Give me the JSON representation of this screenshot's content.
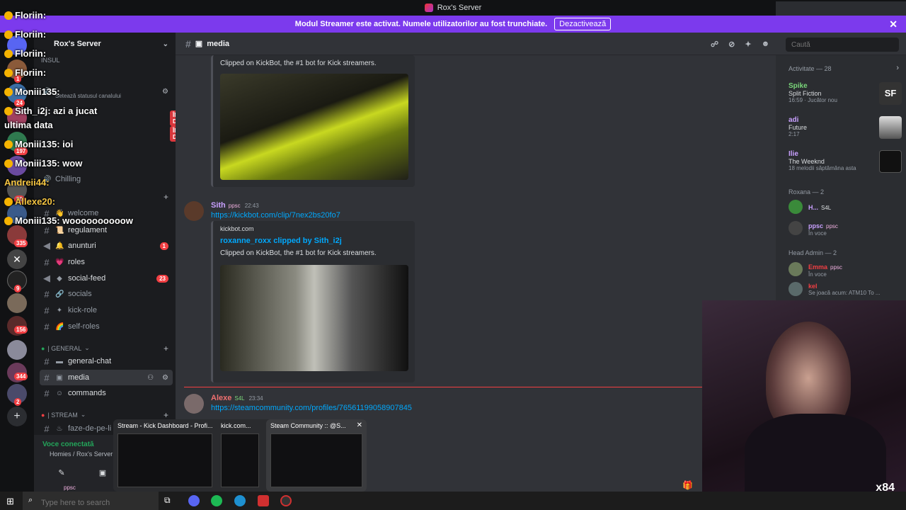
{
  "window": {
    "title": "Rox's Server"
  },
  "banner": {
    "text": "Modul Streamer este activat. Numele utilizatorilor au fost trunchiate.",
    "button": "Dezactivează"
  },
  "server": {
    "name": "Rox's Server"
  },
  "channels": {
    "partial_top": "INSUL",
    "topic_hint": "Setează statusul canalului",
    "live_label": "ÎN DIRECT",
    "chilling": "Chilling",
    "welcome": "welcome",
    "list": [
      {
        "name": "regulament",
        "emoji": "📜"
      },
      {
        "name": "anunturi",
        "emoji": "🔔",
        "count": "1"
      },
      {
        "name": "roles",
        "emoji": "💗"
      },
      {
        "name": "social-feed",
        "emoji": "◆",
        "count": "23"
      },
      {
        "name": "socials",
        "emoji": "🔗"
      },
      {
        "name": "kick-role",
        "emoji": "✦"
      },
      {
        "name": "self-roles",
        "emoji": "🌈"
      }
    ],
    "category_general": "| GENERAL",
    "general_chat": "general-chat",
    "media": "media",
    "commands": "commands",
    "category_stream": "| STREAM",
    "faze": "faze-de-pe-li"
  },
  "voice": {
    "status": "Voce conectată",
    "server": "Homies / Rox's Server"
  },
  "user": {
    "tag": "ppsc"
  },
  "header": {
    "channel": "media",
    "search_placeholder": "Caută"
  },
  "messages": [
    {
      "embed_desc": "Clipped on KickBot, the #1 bot for Kick streamers."
    },
    {
      "user": "Sith",
      "tag": "ppsc",
      "time": "22:43",
      "link": "https://kickbot.com/clip/7nex2bs20fo7",
      "site": "kickbot.com",
      "embed_title": "roxanne_roxx clipped by Sith_i2j",
      "embed_desc": "Clipped on KickBot, the #1 bot for Kick streamers."
    },
    {
      "user": "Alexe",
      "tag": "S4L",
      "time": "23:34",
      "link": "https://steamcommunity.com/profiles/76561199058907845"
    }
  ],
  "activity": {
    "header": "Activitate — 28",
    "items": [
      {
        "user": "Spike",
        "title": "Split Fiction",
        "status": "16:59 · Jucător nou"
      },
      {
        "user": "adi",
        "title": "Future",
        "status": "2:17"
      },
      {
        "user": "Ilie",
        "title": "The Weeknd",
        "status": "18 melodii săptămâna asta"
      }
    ],
    "roxana_header": "Roxana — 2",
    "roxana": [
      {
        "name": "H...",
        "tag": "S4L"
      },
      {
        "name": "ppsc",
        "tag": "ppsc",
        "status": "În voce"
      }
    ],
    "headadmin_header": "Head Admin — 2",
    "headadmin": [
      {
        "name": "Emma",
        "tag": "ppsc",
        "status": "În voce"
      },
      {
        "name": "kel",
        "status": "Se joacă acum: ATM10 To ..."
      }
    ]
  },
  "chat_overlay": [
    {
      "text": "Floriin:"
    },
    {
      "text": "Floriin:"
    },
    {
      "text": "Floriin:"
    },
    {
      "text": "Floriin:"
    },
    {
      "text": "Moniii135:"
    },
    {
      "text": "Sith_i2j: azi a jucat"
    },
    {
      "text": "ultima data"
    },
    {
      "text": "Moniii135: ioi"
    },
    {
      "text": "Moniii135: wow"
    },
    {
      "text": "Andreii44:"
    },
    {
      "text": "Allexe20:"
    },
    {
      "text": "Moniii135: woooooooooow"
    }
  ],
  "guild_badges": [
    "1",
    "24",
    "197",
    "80",
    "335",
    "9",
    "156",
    "344",
    "2"
  ],
  "thumbnails": [
    {
      "label": "Stream - Kick Dashboard - Profi..."
    },
    {
      "label": "kick.com..."
    },
    {
      "label": "Steam Community :: @S..."
    }
  ],
  "taskbar": {
    "search": "Type here to search"
  },
  "webcam": {
    "watermark": "x84"
  },
  "colors": {
    "accent": "#7c3aed",
    "link": "#00a8fc",
    "danger": "#f23f43",
    "online": "#23a55a"
  }
}
